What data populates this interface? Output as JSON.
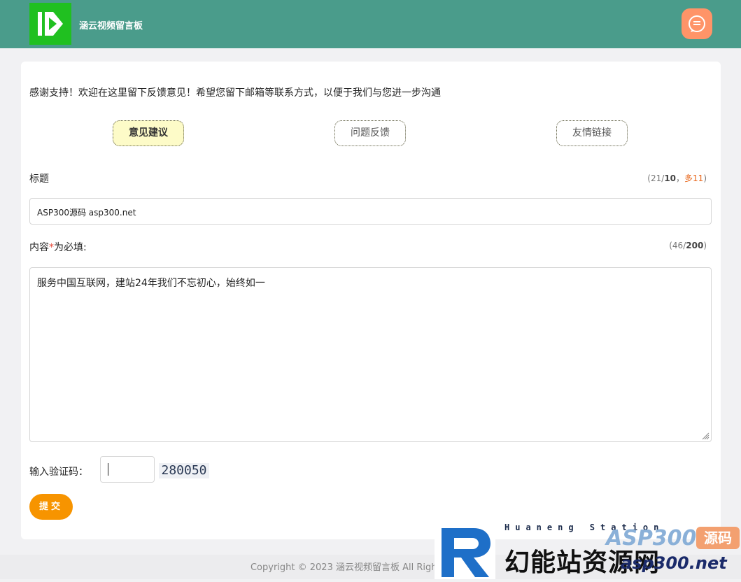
{
  "header": {
    "site_title": "涵云视频留言板",
    "logo_icon": "play-logo-icon",
    "chat_icon": "chat-bubble-icon",
    "brand_color": "#4a9c8b"
  },
  "intro_text": "感谢支持！欢迎在这里留下反馈意见！希望您留下邮箱等联系方式，以便于我们与您进一步沟通",
  "tabs": [
    {
      "label": "意见建议",
      "active": true
    },
    {
      "label": "问题反馈",
      "active": false
    },
    {
      "label": "友情链接",
      "active": false
    }
  ],
  "form": {
    "title_label": "标题",
    "title_counter": {
      "current": "21",
      "limit": "10",
      "over_label": "多11"
    },
    "title_value": "ASP300源码 asp300.net",
    "content_label": "内容",
    "content_required_mark": "*",
    "content_label_suffix": "为必填:",
    "content_counter": {
      "current": "46",
      "limit": "200"
    },
    "content_value": "服务中国互联网，建站24年我们不忘初心，始终如一",
    "captcha_label": "输入验证码：",
    "captcha_value": "",
    "captcha_code": "280050",
    "submit_label": "提交"
  },
  "footer": {
    "text": "Copyright © 2023 涵云视频留言板 All Rights Reserved"
  },
  "watermark": {
    "subtitle": "Huaneng Station",
    "main": "幻能站资源网",
    "brand": "ASP300",
    "tag": "源码",
    "url": "asp300.net"
  }
}
